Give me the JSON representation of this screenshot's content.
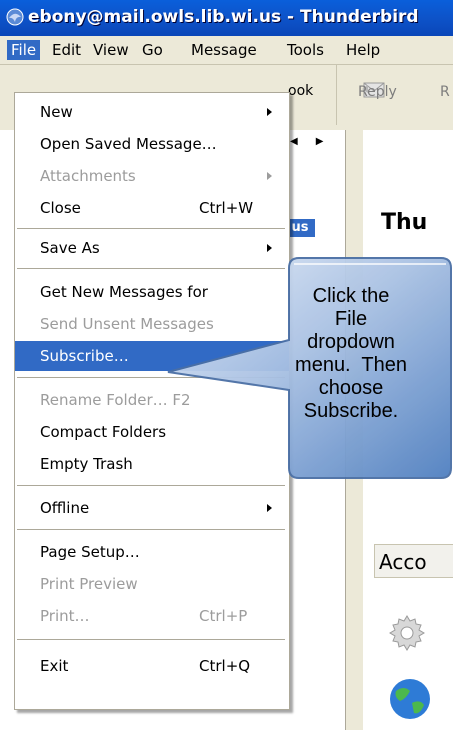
{
  "window": {
    "title": "ebony@mail.owls.lib.wi.us - Thunderbird"
  },
  "menubar": [
    {
      "label": "File"
    },
    {
      "label": "Edit"
    },
    {
      "label": "View"
    },
    {
      "label": "Go"
    },
    {
      "label": "Message"
    },
    {
      "label": "Tools"
    },
    {
      "label": "Help"
    }
  ],
  "toolbar": {
    "address_book_partial": "ook",
    "reply": "Reply",
    "reply_all_partial": "R"
  },
  "folder_pane": {
    "selected_account_partial": "us"
  },
  "right_pane": {
    "heading_partial": "Thu",
    "accounts_partial": "Acco"
  },
  "file_menu": [
    {
      "label": "New",
      "submenu": true
    },
    {
      "label": "Open Saved Message…"
    },
    {
      "label": "Attachments",
      "disabled": true,
      "submenu": true
    },
    {
      "label": "Close",
      "shortcut": "Ctrl+W"
    },
    {
      "label": "Save As",
      "submenu": true
    },
    {
      "label": "Get New Messages for"
    },
    {
      "label": "Send Unsent Messages",
      "disabled": true
    },
    {
      "label": "Subscribe…",
      "highlighted": true
    },
    {
      "label": "Rename Folder… F2",
      "disabled": true
    },
    {
      "label": "Compact Folders"
    },
    {
      "label": "Empty Trash"
    },
    {
      "label": "Offline",
      "submenu": true
    },
    {
      "label": "Page Setup…"
    },
    {
      "label": "Print Preview",
      "disabled": true
    },
    {
      "label": "Print…",
      "shortcut": "Ctrl+P",
      "disabled": true
    },
    {
      "label": "Exit",
      "shortcut": "Ctrl+Q"
    }
  ],
  "callout": {
    "lines": [
      "Click the",
      "File",
      "dropdown",
      "menu.  Then",
      "choose",
      "Subscribe."
    ]
  },
  "colors": {
    "titlebar": "#0A58D0",
    "highlight": "#316AC5",
    "callout": "#4F81BD"
  },
  "icons": [
    "thunderbird-icon",
    "reply-icon",
    "gear-icon",
    "globe-icon"
  ]
}
